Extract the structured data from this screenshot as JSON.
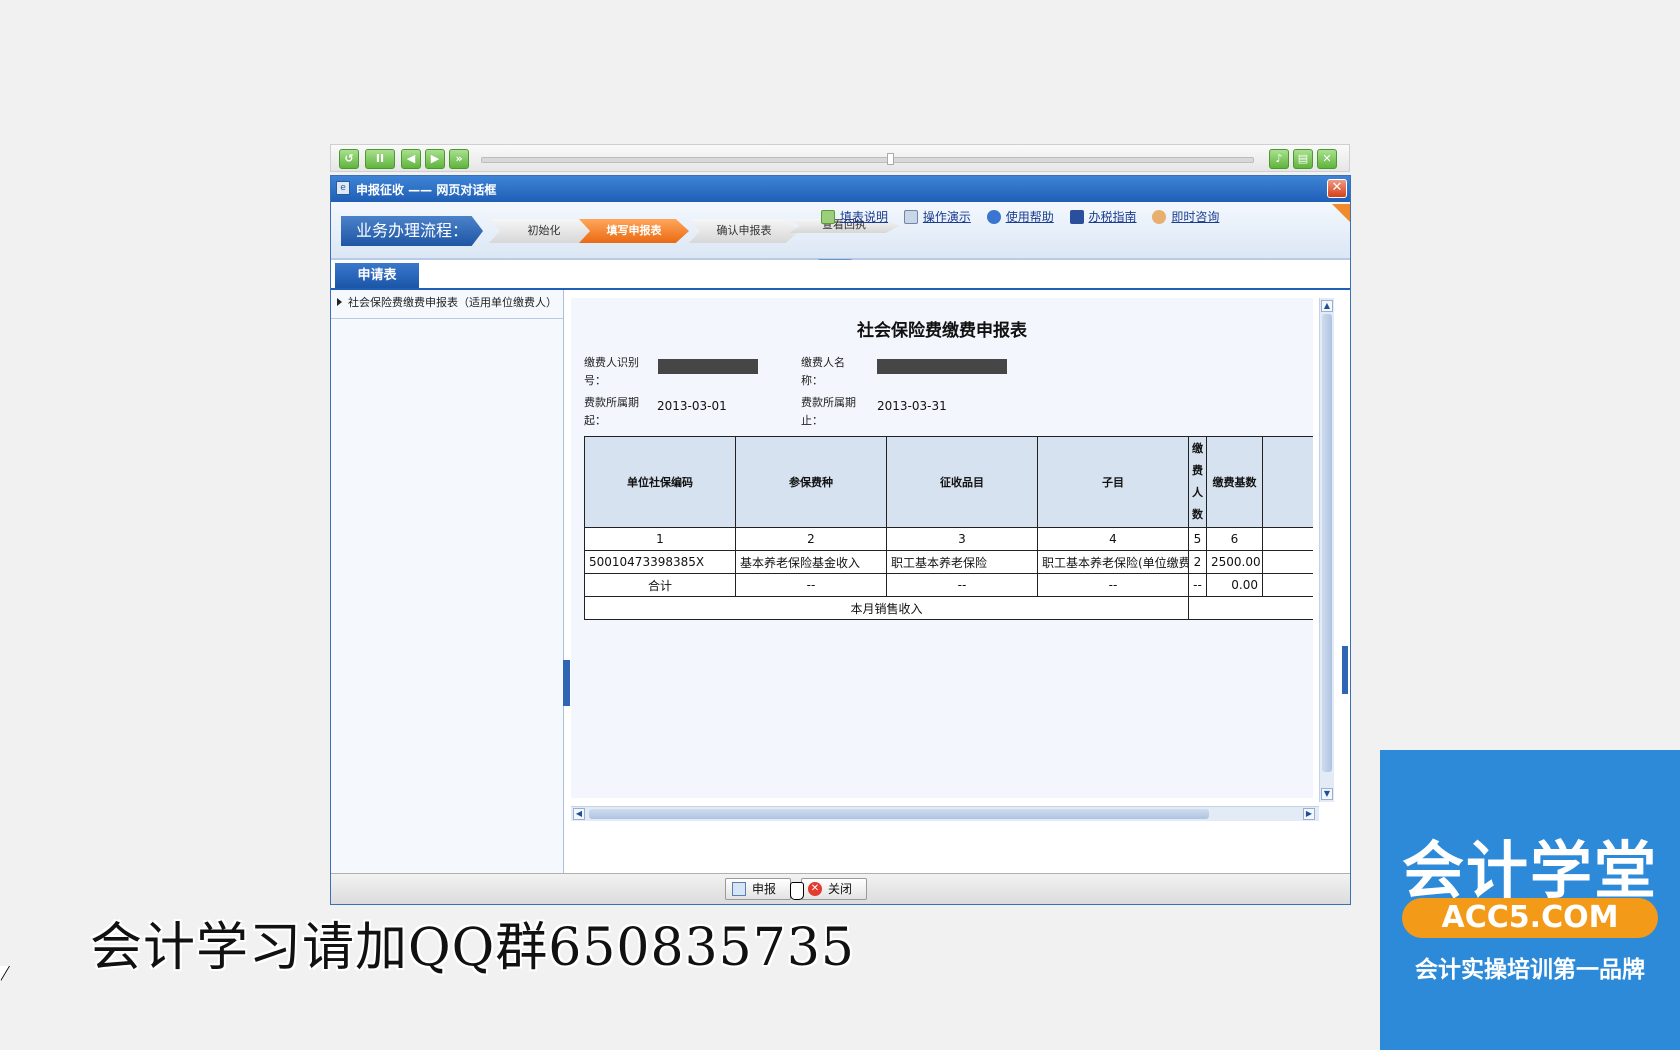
{
  "window": {
    "title": "申报征收 —— 网页对话框",
    "close_glyph": "✕"
  },
  "flow": {
    "label": "业务办理流程：",
    "steps": [
      "初始化",
      "填写申报表",
      "确认申报表",
      "查看回执"
    ]
  },
  "help_links": [
    "填表说明",
    "操作演示",
    "使用帮助",
    "办税指南",
    "即时咨询"
  ],
  "tabs": [
    "申请表"
  ],
  "tree": {
    "items": [
      "社会保险费缴费申报表（适用单位缴费人）"
    ]
  },
  "form": {
    "title": "社会保险费缴费申报表",
    "labels": {
      "payer_id": "缴费人识别号：",
      "payer_name": "缴费人名称：",
      "period_start": "费款所属期起：",
      "period_end": "费款所属期止："
    },
    "values": {
      "period_start": "2013-03-01",
      "period_end": "2013-03-31"
    },
    "table": {
      "headers": [
        "单位社保编码",
        "参保费种",
        "征收品目",
        "子目",
        "缴费人数",
        "缴费基数"
      ],
      "numbers": [
        "1",
        "2",
        "3",
        "4",
        "5",
        "6"
      ],
      "rows": [
        [
          "50010473398385X",
          "基本养老保险基金收入",
          "职工基本养老保险",
          "职工基本养老保险(单位缴费)",
          "2",
          "2500.00"
        ]
      ],
      "total": [
        "合计",
        "--",
        "--",
        "--",
        "--",
        "0.00"
      ],
      "sales_label": "本月销售收入"
    }
  },
  "footer": {
    "submit": "申报",
    "close": "关闭"
  },
  "caption": "会计学习请加QQ群650835735",
  "logo": {
    "main": "会计学堂",
    "domain": "ACC5.COM",
    "slogan": "会计实操培训第一品牌"
  },
  "media_controls": [
    "replay-icon",
    "pause-icon",
    "prev-icon",
    "next-icon",
    "fast-forward-icon",
    "volume-icon",
    "save-icon",
    "close-icon"
  ]
}
